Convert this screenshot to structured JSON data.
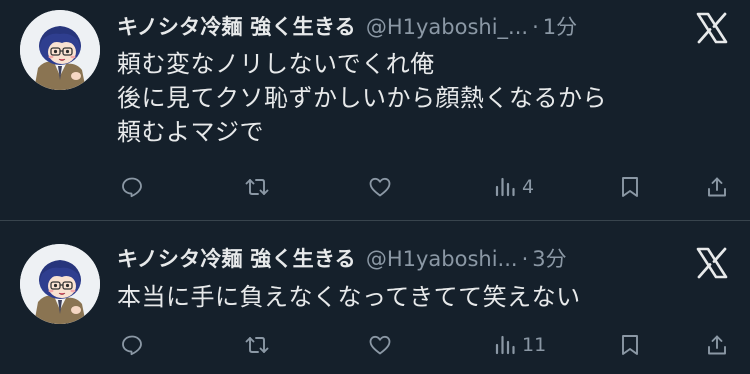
{
  "tweets": [
    {
      "display_name": "キノシタ冷麺 強く生きる",
      "handle": "@H1yaboshi_...",
      "separator": "·",
      "time": "1分",
      "lines": [
        "頼む変なノリしないでくれ俺",
        "後に見てクソ恥ずかしいから顔熱くなるから",
        "頼むよマジで"
      ],
      "actions": {
        "reply_count": "",
        "retweet_count": "",
        "like_count": "",
        "views_count": "4"
      }
    },
    {
      "display_name": "キノシタ冷麺 強く生きる",
      "handle": "@H1yaboshi...",
      "separator": "·",
      "time": "3分",
      "lines": [
        "本当に手に負えなくなってきてて笑えない"
      ],
      "actions": {
        "reply_count": "",
        "retweet_count": "",
        "like_count": "",
        "views_count": "11"
      }
    }
  ],
  "icons": {
    "platform_logo": "x-logo-icon",
    "reply": "reply-icon",
    "retweet": "retweet-icon",
    "like": "heart-icon",
    "views": "views-icon",
    "bookmark": "bookmark-icon",
    "share": "share-icon"
  },
  "colors": {
    "background": "#15202b",
    "primary_text": "#e7e9ea",
    "secondary_text": "#8b98a5",
    "divider": "#38444d"
  }
}
